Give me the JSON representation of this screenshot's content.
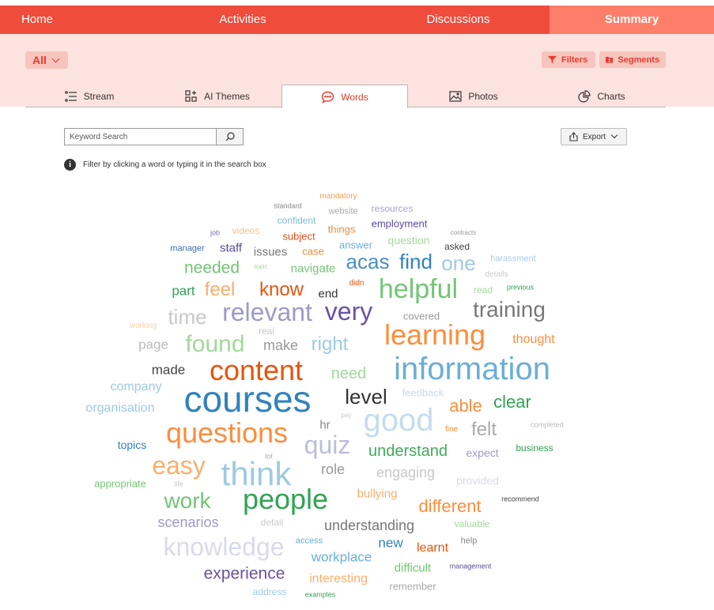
{
  "nav": {
    "home": "Home",
    "activities": "Activities",
    "discussions": "Discussions",
    "summary": "Summary"
  },
  "filter_bar": {
    "all_label": "All",
    "filters_label": "Filters",
    "segments_label": "Segments"
  },
  "tabs": {
    "stream": "Stream",
    "ai_themes": "AI Themes",
    "words": "Words",
    "photos": "Photos",
    "charts": "Charts",
    "active": "Words"
  },
  "search": {
    "placeholder": "Keyword Search"
  },
  "export_label": "Export",
  "info_text": "Filter by clicking a word or typing it in the search box",
  "colors": {
    "brand": "#ef4c3c",
    "nav_active": "#ff7e6a",
    "band": "#fde3df",
    "pill": "#f7c5bd",
    "accent_text": "#e83a2d"
  },
  "word_cloud": [
    {
      "text": "mandatory",
      "c": "#f0a050"
    },
    {
      "text": "standard",
      "c": "#888888"
    },
    {
      "text": "website",
      "c": "#aaaaaa"
    },
    {
      "text": "resources",
      "c": "#a9a3d4"
    },
    {
      "text": "confident",
      "c": "#7fb8d8"
    },
    {
      "text": "employment",
      "c": "#5b4a9e"
    },
    {
      "text": "job",
      "c": "#7b6bb0"
    },
    {
      "text": "videos",
      "c": "#f7c28a"
    },
    {
      "text": "subject",
      "c": "#d9531e"
    },
    {
      "text": "things",
      "c": "#f08a3a"
    },
    {
      "text": "question",
      "c": "#a6d9a0"
    },
    {
      "text": "contracts",
      "c": "#999999"
    },
    {
      "text": "manager",
      "c": "#3a6ea5"
    },
    {
      "text": "staff",
      "c": "#5b4a9e"
    },
    {
      "text": "issues",
      "c": "#777777"
    },
    {
      "text": "case",
      "c": "#f08a3a"
    },
    {
      "text": "answer",
      "c": "#6baed6"
    },
    {
      "text": "asked",
      "c": "#444444"
    },
    {
      "text": "harassment",
      "c": "#a9cbe6"
    },
    {
      "text": "needed",
      "c": "#74c476"
    },
    {
      "text": "topic",
      "c": "#a6d9a0"
    },
    {
      "text": "navigate",
      "c": "#74c476"
    },
    {
      "text": "acas",
      "c": "#4a90c2"
    },
    {
      "text": "find",
      "c": "#3182bd"
    },
    {
      "text": "one",
      "c": "#9ecae1"
    },
    {
      "text": "details",
      "c": "#c8c8c8"
    },
    {
      "text": "part",
      "c": "#31a354"
    },
    {
      "text": "feel",
      "c": "#fdae6b"
    },
    {
      "text": "know",
      "c": "#e6550d"
    },
    {
      "text": "didn",
      "c": "#e6550d"
    },
    {
      "text": "end",
      "c": "#333333"
    },
    {
      "text": "helpful",
      "c": "#74c476"
    },
    {
      "text": "read",
      "c": "#a6d9a0"
    },
    {
      "text": "previous",
      "c": "#31a354"
    },
    {
      "text": "time",
      "c": "#c8c8c8"
    },
    {
      "text": "relevant",
      "c": "#9e9ac8"
    },
    {
      "text": "very",
      "c": "#6a51a3"
    },
    {
      "text": "training",
      "c": "#777777"
    },
    {
      "text": "working",
      "c": "#fdd0a2"
    },
    {
      "text": "real",
      "c": "#c8c8c8"
    },
    {
      "text": "covered",
      "c": "#999999"
    },
    {
      "text": "learning",
      "c": "#fd8d3c"
    },
    {
      "text": "page",
      "c": "#bbbbbb"
    },
    {
      "text": "found",
      "c": "#a1d99b"
    },
    {
      "text": "make",
      "c": "#999999"
    },
    {
      "text": "right",
      "c": "#9ecae1"
    },
    {
      "text": "thought",
      "c": "#fd8d3c"
    },
    {
      "text": "made",
      "c": "#444444"
    },
    {
      "text": "content",
      "c": "#e6550d"
    },
    {
      "text": "need",
      "c": "#a1d99b"
    },
    {
      "text": "information",
      "c": "#6baed6"
    },
    {
      "text": "company",
      "c": "#9ecae1"
    },
    {
      "text": "courses",
      "c": "#3182bd"
    },
    {
      "text": "level",
      "c": "#333333"
    },
    {
      "text": "feedback",
      "c": "#c6dbef"
    },
    {
      "text": "clear",
      "c": "#31a354"
    },
    {
      "text": "organisation",
      "c": "#9ecae1"
    },
    {
      "text": "able",
      "c": "#fd8d3c"
    },
    {
      "text": "good",
      "c": "#c6dbef"
    },
    {
      "text": "pay",
      "c": "#c8c8c8"
    },
    {
      "text": "hr",
      "c": "#888888"
    },
    {
      "text": "questions",
      "c": "#fd8d3c"
    },
    {
      "text": "fine",
      "c": "#fd8d3c"
    },
    {
      "text": "felt",
      "c": "#aaaaaa"
    },
    {
      "text": "completed",
      "c": "#bbbbbb"
    },
    {
      "text": "topics",
      "c": "#3182bd"
    },
    {
      "text": "quiz",
      "c": "#bcbddc"
    },
    {
      "text": "understand",
      "c": "#41ab5d"
    },
    {
      "text": "expect",
      "c": "#9e9ac8"
    },
    {
      "text": "business",
      "c": "#31a354"
    },
    {
      "text": "easy",
      "c": "#fdae6b"
    },
    {
      "text": "lot",
      "c": "#aaaaaa"
    },
    {
      "text": "think",
      "c": "#9ecae1"
    },
    {
      "text": "role",
      "c": "#999999"
    },
    {
      "text": "engaging",
      "c": "#c8c8c8"
    },
    {
      "text": "provided",
      "c": "#dadaeb"
    },
    {
      "text": "appropriate",
      "c": "#74c476"
    },
    {
      "text": "life",
      "c": "#c8c8c8"
    },
    {
      "text": "bullying",
      "c": "#fdae6b"
    },
    {
      "text": "work",
      "c": "#74c476"
    },
    {
      "text": "people",
      "c": "#31a354"
    },
    {
      "text": "different",
      "c": "#fd8d3c"
    },
    {
      "text": "recommend",
      "c": "#444444"
    },
    {
      "text": "scenarios",
      "c": "#9e9ac8"
    },
    {
      "text": "detail",
      "c": "#cccccc"
    },
    {
      "text": "understanding",
      "c": "#777777"
    },
    {
      "text": "valuable",
      "c": "#a1d99b"
    },
    {
      "text": "knowledge",
      "c": "#dadaeb"
    },
    {
      "text": "access",
      "c": "#6baed6"
    },
    {
      "text": "new",
      "c": "#3182bd"
    },
    {
      "text": "learnt",
      "c": "#e6550d"
    },
    {
      "text": "help",
      "c": "#888888"
    },
    {
      "text": "experience",
      "c": "#6a51a3"
    },
    {
      "text": "workplace",
      "c": "#6baed6"
    },
    {
      "text": "difficult",
      "c": "#74c476"
    },
    {
      "text": "management",
      "c": "#5b4a9e"
    },
    {
      "text": "interesting",
      "c": "#fdae6b"
    },
    {
      "text": "address",
      "c": "#9ecae1"
    },
    {
      "text": "examples",
      "c": "#31a354"
    },
    {
      "text": "remember",
      "c": "#aaaaaa"
    }
  ]
}
